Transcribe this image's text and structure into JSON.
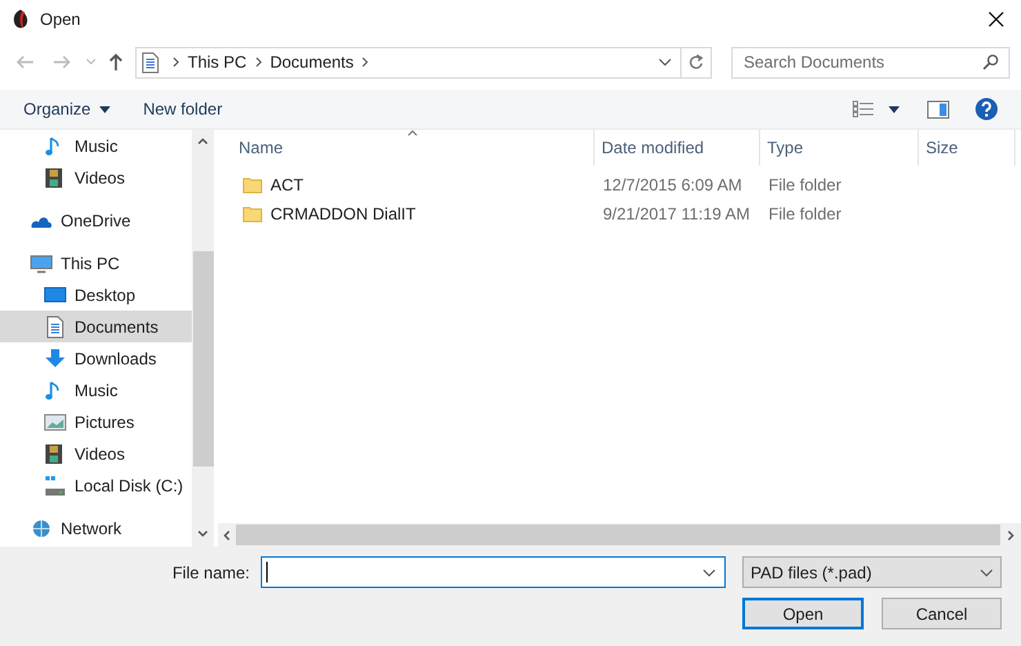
{
  "window": {
    "title": "Open"
  },
  "address": {
    "crumbs": [
      "This PC",
      "Documents"
    ],
    "search_placeholder": "Search Documents"
  },
  "toolbar": {
    "organize": "Organize",
    "new_folder": "New folder"
  },
  "nav": [
    {
      "label": "Music",
      "kind": "music",
      "level2": true,
      "selected": false
    },
    {
      "label": "Videos",
      "kind": "videos",
      "level2": true,
      "selected": false
    },
    {
      "label": "OneDrive",
      "kind": "cloud",
      "level2": false,
      "selected": false
    },
    {
      "label": "This PC",
      "kind": "pc",
      "level2": false,
      "selected": false
    },
    {
      "label": "Desktop",
      "kind": "desktop",
      "level2": true,
      "selected": false
    },
    {
      "label": "Documents",
      "kind": "documents",
      "level2": true,
      "selected": true
    },
    {
      "label": "Downloads",
      "kind": "downloads",
      "level2": true,
      "selected": false
    },
    {
      "label": "Music",
      "kind": "music",
      "level2": true,
      "selected": false
    },
    {
      "label": "Pictures",
      "kind": "pictures",
      "level2": true,
      "selected": false
    },
    {
      "label": "Videos",
      "kind": "videos",
      "level2": true,
      "selected": false
    },
    {
      "label": "Local Disk (C:)",
      "kind": "disk",
      "level2": true,
      "selected": false
    },
    {
      "label": "Network",
      "kind": "network",
      "level2": false,
      "selected": false
    }
  ],
  "table": {
    "columns": [
      "Name",
      "Date modified",
      "Type",
      "Size"
    ],
    "rows": [
      {
        "name": "ACT",
        "date": "12/7/2015 6:09 AM",
        "type": "File folder"
      },
      {
        "name": "CRMADDON DialIT",
        "date": "9/21/2017 11:19 AM",
        "type": "File folder"
      }
    ]
  },
  "footer": {
    "file_name_label": "File name:",
    "file_type": "PAD files (*.pad)",
    "open": "Open",
    "cancel": "Cancel"
  }
}
